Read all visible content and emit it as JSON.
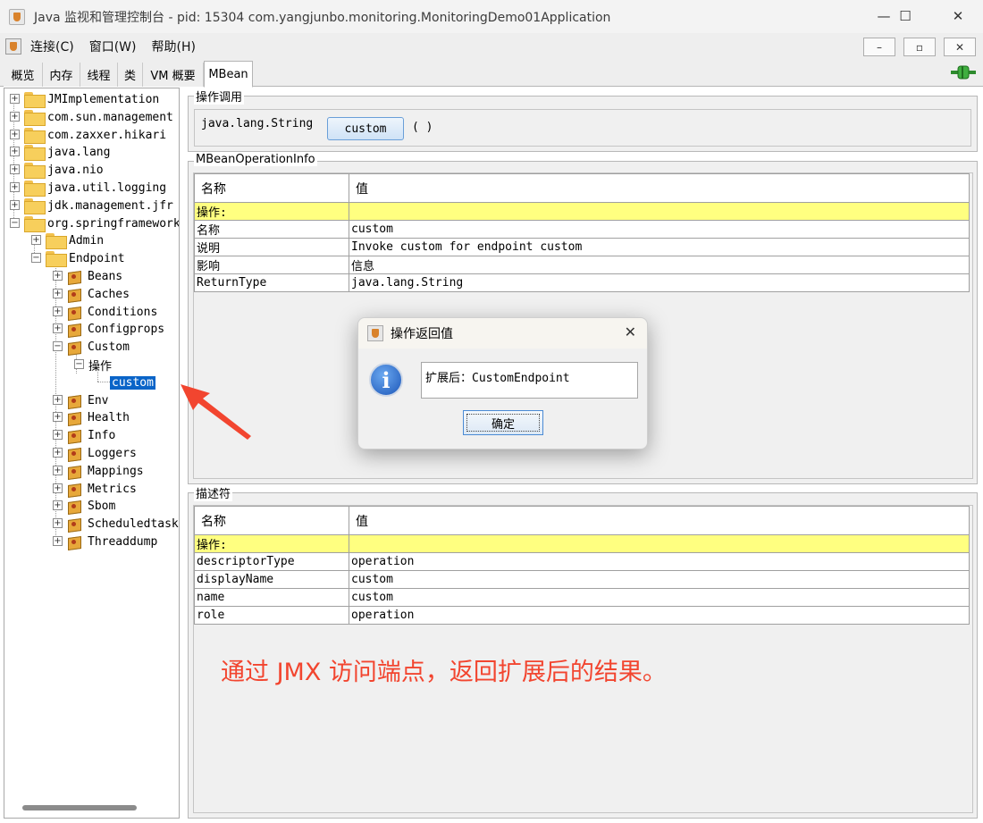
{
  "window": {
    "title": "Java 监视和管理控制台 - pid: 15304 com.yangjunbo.monitoring.MonitoringDemo01Application",
    "controls": [
      "—",
      "☐",
      "✕"
    ]
  },
  "menu": {
    "items": [
      "连接(C)",
      "窗口(W)",
      "帮助(H)"
    ],
    "mdi_buttons": [
      "–",
      "▫",
      "✕"
    ]
  },
  "tabs": [
    "概览",
    "内存",
    "线程",
    "类",
    "VM 概要",
    "MBean"
  ],
  "active_tab": "MBean",
  "tree": {
    "roots": [
      "JMImplementation",
      "com.sun.management",
      "com.zaxxer.hikari",
      "java.lang",
      "java.nio",
      "java.util.logging",
      "jdk.management.jfr",
      "org.springframework"
    ],
    "spring_children": [
      "Admin",
      "Endpoint"
    ],
    "endpoint_beans_before": [
      "Beans",
      "Caches",
      "Conditions",
      "Configprops",
      "Custom"
    ],
    "custom_child": "操作",
    "operation_leaf": "custom",
    "endpoint_beans_after": [
      "Env",
      "Health",
      "Info",
      "Loggers",
      "Mappings",
      "Metrics",
      "Sbom",
      "Scheduledtasks",
      "Threaddump"
    ]
  },
  "operation_invoke": {
    "title": "操作调用",
    "return_type": "java.lang.String",
    "button_label": "custom",
    "params": "( )"
  },
  "mbean_operation_info": {
    "title": "MBeanOperationInfo",
    "col_name": "名称",
    "col_value": "值",
    "section": "操作:",
    "rows": [
      {
        "name": "名称",
        "value": "custom"
      },
      {
        "name": "说明",
        "value": "Invoke custom for endpoint custom"
      },
      {
        "name": "影响",
        "value": "信息"
      },
      {
        "name": "ReturnType",
        "value": "java.lang.String"
      }
    ]
  },
  "descriptor": {
    "title": "描述符",
    "col_name": "名称",
    "col_value": "值",
    "section": "操作:",
    "rows": [
      {
        "name": "descriptorType",
        "value": "operation"
      },
      {
        "name": "displayName",
        "value": "custom"
      },
      {
        "name": "name",
        "value": "custom"
      },
      {
        "name": "role",
        "value": "operation"
      }
    ]
  },
  "dialog": {
    "title": "操作返回值",
    "close": "✕",
    "info_icon": "i",
    "message": "扩展后：CustomEndpoint",
    "ok_label": "确定"
  },
  "annotation": {
    "text": "通过 JMX 访问端点，返回扩展后的结果。",
    "color": "#f2452f"
  }
}
